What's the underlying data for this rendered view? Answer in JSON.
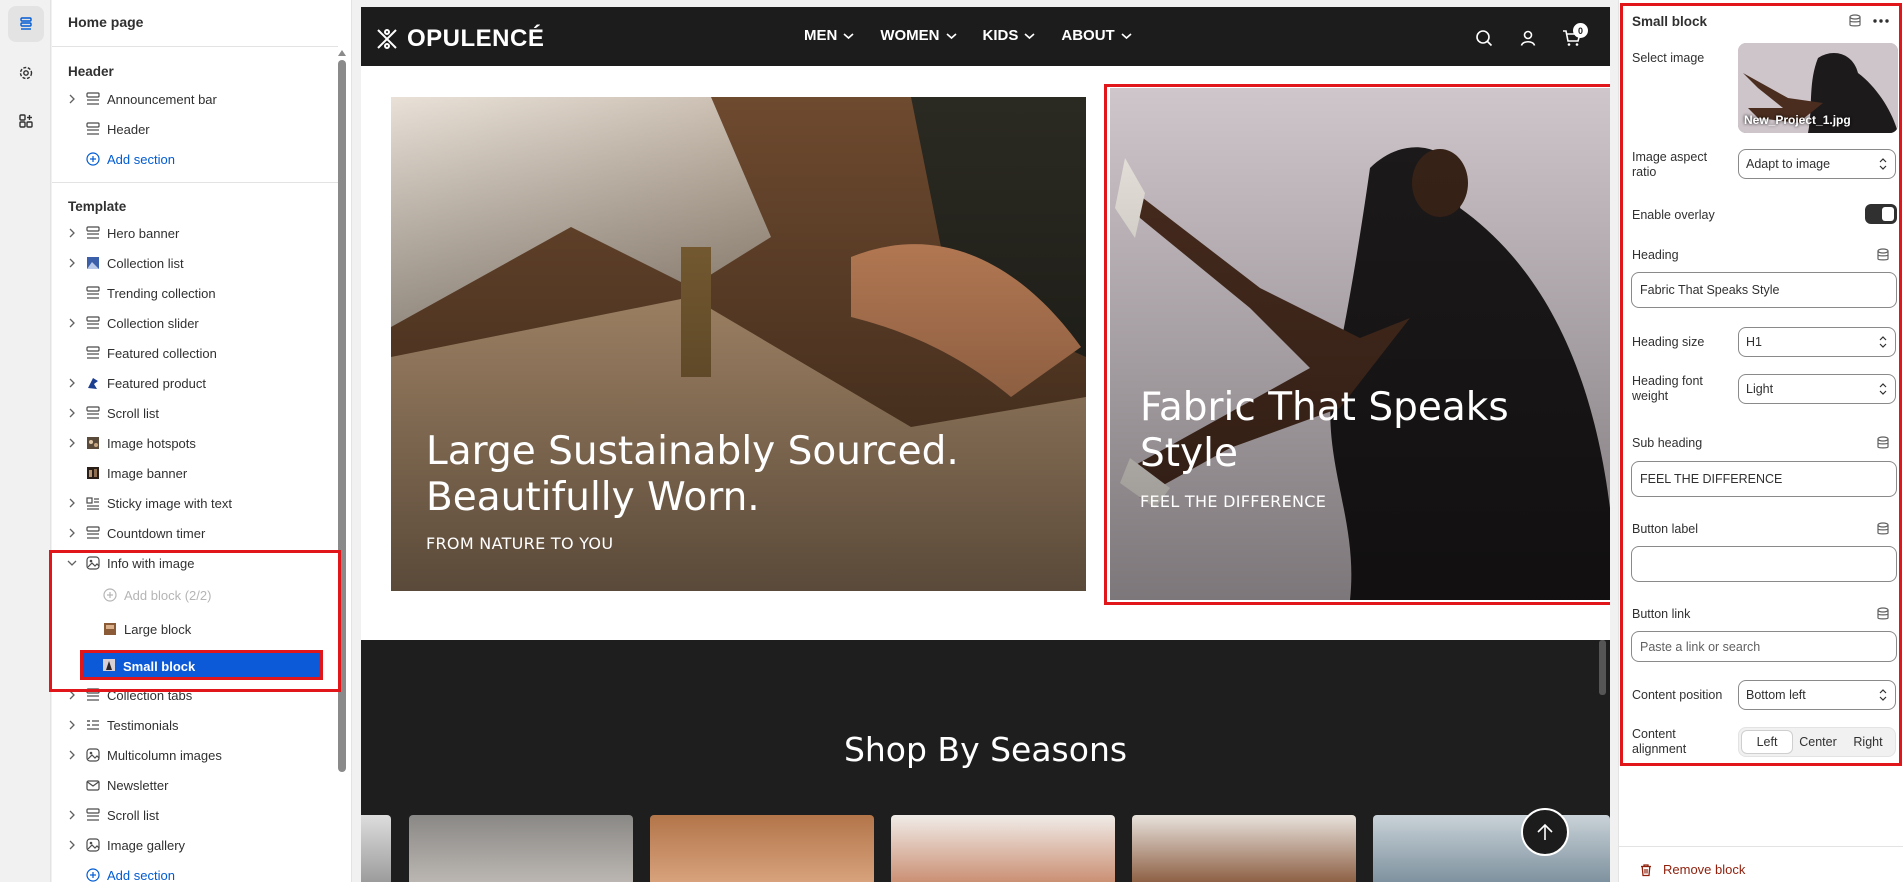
{
  "tree": {
    "title": "Home page",
    "header_group": "Header",
    "header_items": [
      {
        "label": "Announcement bar",
        "icon": "section-icon",
        "expandable": true
      },
      {
        "label": "Header",
        "icon": "section-icon",
        "expandable": false
      }
    ],
    "header_add": "Add section",
    "template_group": "Template",
    "template_items": [
      {
        "label": "Hero banner",
        "icon": "section-icon",
        "expandable": true
      },
      {
        "label": "Collection list",
        "icon": "image-thumb-icon",
        "expandable": true
      },
      {
        "label": "Trending collection",
        "icon": "section-icon",
        "expandable": false
      },
      {
        "label": "Collection slider",
        "icon": "section-icon",
        "expandable": true
      },
      {
        "label": "Featured collection",
        "icon": "section-icon",
        "expandable": false
      },
      {
        "label": "Featured product",
        "icon": "product-thumb-icon",
        "expandable": true
      },
      {
        "label": "Scroll list",
        "icon": "section-icon",
        "expandable": true
      },
      {
        "label": "Image hotspots",
        "icon": "hotspot-thumb-icon",
        "expandable": true
      },
      {
        "label": "Image banner",
        "icon": "banner-thumb-icon",
        "expandable": false
      },
      {
        "label": "Sticky image with text",
        "icon": "text-image-icon",
        "expandable": true
      },
      {
        "label": "Countdown timer",
        "icon": "section-icon",
        "expandable": true
      },
      {
        "label": "Info with image",
        "icon": "image-section-icon",
        "expandable": true,
        "expanded": true
      }
    ],
    "info_children": {
      "add_block": "Add block (2/2)",
      "large_block": "Large block",
      "small_block": "Small block"
    },
    "template_items_after": [
      {
        "label": "Collection tabs",
        "icon": "section-icon",
        "expandable": true
      },
      {
        "label": "Testimonials",
        "icon": "list-icon",
        "expandable": true
      },
      {
        "label": "Multicolumn images",
        "icon": "image-section-icon",
        "expandable": true
      },
      {
        "label": "Newsletter",
        "icon": "mail-icon",
        "expandable": false
      },
      {
        "label": "Scroll list",
        "icon": "section-icon",
        "expandable": true
      },
      {
        "label": "Image gallery",
        "icon": "image-section-icon",
        "expandable": true
      }
    ],
    "template_add": "Add section"
  },
  "preview": {
    "logo": "OPULENCÉ",
    "nav": [
      {
        "label": "MEN"
      },
      {
        "label": "WOMEN"
      },
      {
        "label": "KIDS"
      },
      {
        "label": "ABOUT"
      }
    ],
    "cart_count": "0",
    "large_block": {
      "heading": "Large Sustainably Sourced. Beautifully Worn.",
      "sub": "FROM NATURE TO YOU"
    },
    "small_block": {
      "heading": "Fabric That Speaks Style",
      "sub": "FEEL THE DIFFERENCE"
    },
    "seasons_title": "Shop By Seasons"
  },
  "settings": {
    "title": "Small block",
    "select_image_label": "Select image",
    "image_filename": "New_Project_1.jpg",
    "aspect_label": "Image aspect ratio",
    "aspect_value": "Adapt to image",
    "overlay_label": "Enable overlay",
    "overlay_on": true,
    "heading_label": "Heading",
    "heading_value": "Fabric That Speaks Style",
    "heading_size_label": "Heading size",
    "heading_size_value": "H1",
    "heading_weight_label": "Heading font weight",
    "heading_weight_value": "Light",
    "sub_heading_label": "Sub heading",
    "sub_heading_value": "FEEL THE DIFFERENCE",
    "button_label_label": "Button label",
    "button_label_value": "",
    "button_link_label": "Button link",
    "button_link_placeholder": "Paste a link or search",
    "content_position_label": "Content position",
    "content_position_value": "Bottom left",
    "content_alignment_label": "Content alignment",
    "alignment_options": [
      "Left",
      "Center",
      "Right"
    ],
    "alignment_selected": "Left",
    "remove_label": "Remove block"
  },
  "colors": {
    "highlight_red": "#e0161a",
    "selected_blue": "#0d5ad8",
    "link_blue": "#005bd3",
    "nav_dark": "#1c1c1c",
    "remove_red": "#8e1f0b"
  }
}
